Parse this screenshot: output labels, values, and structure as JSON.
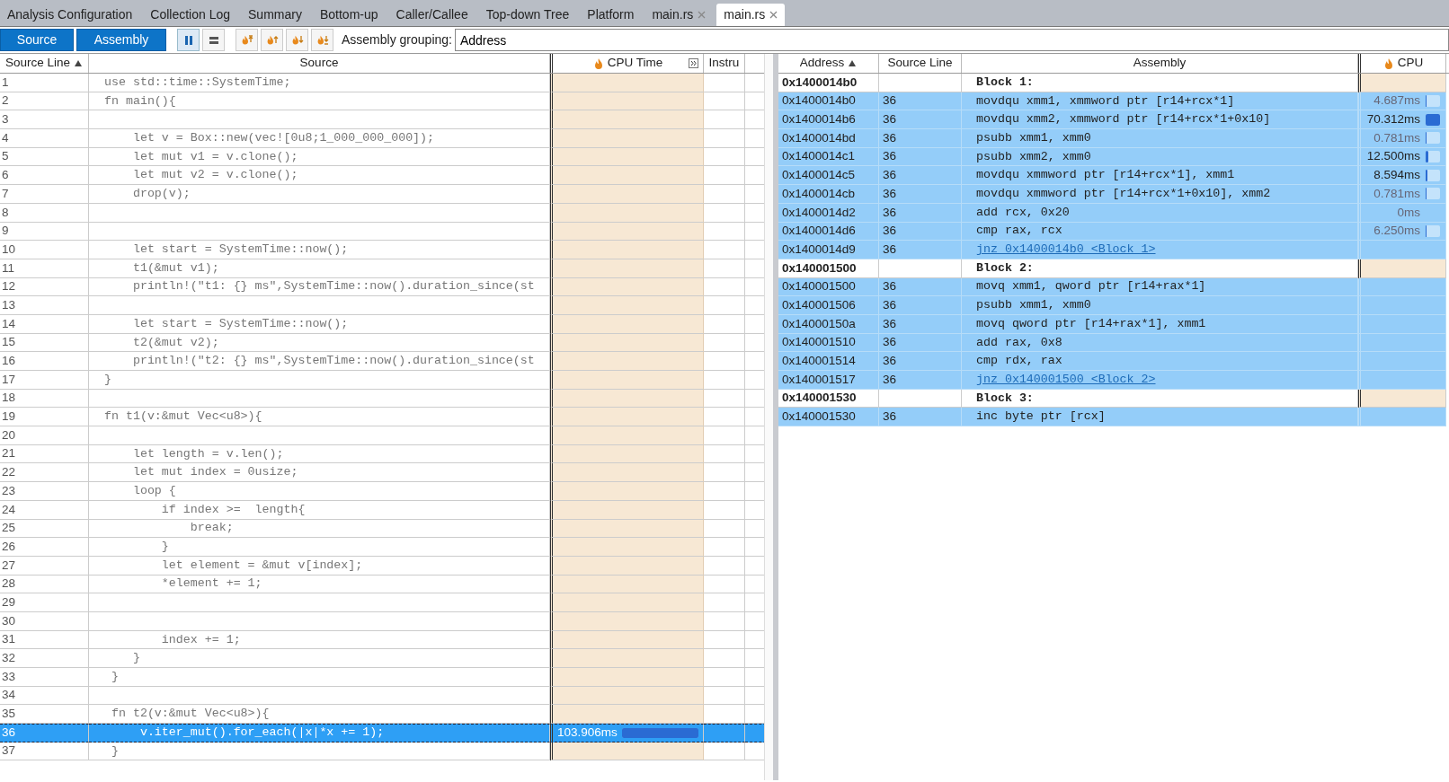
{
  "tabs": [
    {
      "label": "Analysis Configuration",
      "closable": false,
      "selected": false
    },
    {
      "label": "Collection Log",
      "closable": false,
      "selected": false
    },
    {
      "label": "Summary",
      "closable": false,
      "selected": false
    },
    {
      "label": "Bottom-up",
      "closable": false,
      "selected": false
    },
    {
      "label": "Caller/Callee",
      "closable": false,
      "selected": false
    },
    {
      "label": "Top-down Tree",
      "closable": false,
      "selected": false
    },
    {
      "label": "Platform",
      "closable": false,
      "selected": false
    },
    {
      "label": "main.rs",
      "closable": true,
      "selected": false
    },
    {
      "label": "main.rs",
      "closable": true,
      "selected": true
    }
  ],
  "toolbar": {
    "view_buttons": [
      {
        "label": "Source",
        "selected": true
      },
      {
        "label": "Assembly",
        "selected": true
      }
    ],
    "layout_buttons": [
      {
        "kind": "columns",
        "selected": true
      },
      {
        "kind": "rows",
        "selected": false
      }
    ],
    "navigation_buttons": [
      {
        "kind": "top"
      },
      {
        "kind": "up"
      },
      {
        "kind": "down"
      },
      {
        "kind": "bottom"
      }
    ],
    "grouping": {
      "label": "Assembly grouping:",
      "value": "Address"
    }
  },
  "source_pane": {
    "columns": [
      {
        "label": "Source Line",
        "kind": "text",
        "sorted": true
      },
      {
        "label": "Source",
        "kind": "text",
        "sorted": false
      },
      {
        "label": "CPU Time",
        "kind": "metric",
        "sorted": false
      },
      {
        "label": "Instru",
        "kind": "text",
        "sorted": false
      }
    ],
    "rows": [
      {
        "line": "1",
        "code": "use std::time::SystemTime;",
        "selected": false
      },
      {
        "line": "2",
        "code": "fn main(){",
        "selected": false
      },
      {
        "line": "3",
        "code": "",
        "selected": false
      },
      {
        "line": "4",
        "code": "    let v = Box::new(vec![0u8;1_000_000_000]);",
        "selected": false
      },
      {
        "line": "5",
        "code": "    let mut v1 = v.clone();",
        "selected": false
      },
      {
        "line": "6",
        "code": "    let mut v2 = v.clone();",
        "selected": false
      },
      {
        "line": "7",
        "code": "    drop(v);",
        "selected": false
      },
      {
        "line": "8",
        "code": "",
        "selected": false
      },
      {
        "line": "9",
        "code": "",
        "selected": false
      },
      {
        "line": "10",
        "code": "    let start = SystemTime::now();",
        "selected": false
      },
      {
        "line": "11",
        "code": "    t1(&mut v1);",
        "selected": false
      },
      {
        "line": "12",
        "code": "    println!(\"t1: {} ms\",SystemTime::now().duration_since(st",
        "selected": false
      },
      {
        "line": "13",
        "code": "",
        "selected": false
      },
      {
        "line": "14",
        "code": "    let start = SystemTime::now();",
        "selected": false
      },
      {
        "line": "15",
        "code": "    t2(&mut v2);",
        "selected": false
      },
      {
        "line": "16",
        "code": "    println!(\"t2: {} ms\",SystemTime::now().duration_since(st",
        "selected": false
      },
      {
        "line": "17",
        "code": "}",
        "selected": false
      },
      {
        "line": "18",
        "code": "",
        "selected": false
      },
      {
        "line": "19",
        "code": "fn t1(v:&mut Vec<u8>){",
        "selected": false
      },
      {
        "line": "20",
        "code": "",
        "selected": false
      },
      {
        "line": "21",
        "code": "    let length = v.len();",
        "selected": false
      },
      {
        "line": "22",
        "code": "    let mut index = 0usize;",
        "selected": false
      },
      {
        "line": "23",
        "code": "    loop {",
        "selected": false
      },
      {
        "line": "24",
        "code": "        if index >=  length{",
        "selected": false
      },
      {
        "line": "25",
        "code": "            break;",
        "selected": false
      },
      {
        "line": "26",
        "code": "        }",
        "selected": false
      },
      {
        "line": "27",
        "code": "        let element = &mut v[index];",
        "selected": false
      },
      {
        "line": "28",
        "code": "        *element += 1;",
        "selected": false
      },
      {
        "line": "29",
        "code": "",
        "selected": false
      },
      {
        "line": "30",
        "code": "",
        "selected": false
      },
      {
        "line": "31",
        "code": "        index += 1;",
        "selected": false
      },
      {
        "line": "32",
        "code": "    }",
        "selected": false
      },
      {
        "line": "33",
        "code": " }",
        "selected": false
      },
      {
        "line": "34",
        "code": "",
        "selected": false
      },
      {
        "line": "35",
        "code": " fn t2(v:&mut Vec<u8>){",
        "selected": false
      },
      {
        "line": "36",
        "code": "     v.iter_mut().for_each(|x|*x += 1);",
        "selected": true,
        "cpu_time": "103.906ms",
        "level": 1
      },
      {
        "line": "37",
        "code": " }",
        "selected": false
      }
    ]
  },
  "assembly_pane": {
    "columns": [
      {
        "label": "Address",
        "kind": "text",
        "sorted": true
      },
      {
        "label": "Source Line",
        "kind": "text",
        "sorted": false
      },
      {
        "label": "Assembly",
        "kind": "text",
        "sorted": false
      },
      {
        "label": "CPU",
        "kind": "metric",
        "sorted": false
      }
    ],
    "rows": [
      {
        "kind": "block",
        "address": "0x1400014b0",
        "instruction": "Block 1:",
        "selected": false
      },
      {
        "kind": "instruction",
        "address": "0x1400014b0",
        "source_line": "36",
        "instruction": "movdqu xmm1, xmmword ptr [r14+rcx*1]",
        "cpu_time": "4.687ms",
        "muted": true,
        "level": 0.067,
        "selected": true
      },
      {
        "kind": "instruction",
        "address": "0x1400014b6",
        "source_line": "36",
        "instruction": "movdqu xmm2, xmmword ptr [r14+rcx*1+0x10]",
        "cpu_time": "70.312ms",
        "muted": false,
        "level": 1,
        "selected": true
      },
      {
        "kind": "instruction",
        "address": "0x1400014bd",
        "source_line": "36",
        "instruction": "psubb xmm1, xmm0",
        "cpu_time": "0.781ms",
        "muted": true,
        "level": 0.011,
        "selected": true
      },
      {
        "kind": "instruction",
        "address": "0x1400014c1",
        "source_line": "36",
        "instruction": "psubb xmm2, xmm0",
        "cpu_time": "12.500ms",
        "muted": false,
        "level": 0.178,
        "selected": true
      },
      {
        "kind": "instruction",
        "address": "0x1400014c5",
        "source_line": "36",
        "instruction": "movdqu xmmword ptr [r14+rcx*1], xmm1",
        "cpu_time": "8.594ms",
        "muted": false,
        "level": 0.122,
        "selected": true
      },
      {
        "kind": "instruction",
        "address": "0x1400014cb",
        "source_line": "36",
        "instruction": "movdqu xmmword ptr [r14+rcx*1+0x10], xmm2",
        "cpu_time": "0.781ms",
        "muted": true,
        "level": 0.011,
        "selected": true
      },
      {
        "kind": "instruction",
        "address": "0x1400014d2",
        "source_line": "36",
        "instruction": "add rcx, 0x20",
        "cpu_time": "0ms",
        "muted": true,
        "selected": true
      },
      {
        "kind": "instruction",
        "address": "0x1400014d6",
        "source_line": "36",
        "instruction": "cmp rax, rcx",
        "cpu_time": "6.250ms",
        "muted": true,
        "level": 0.089,
        "selected": true
      },
      {
        "kind": "jump",
        "address": "0x1400014d9",
        "source_line": "36",
        "instruction": "jnz 0x1400014b0 <Block 1>",
        "selected": true
      },
      {
        "kind": "block",
        "address": "0x140001500",
        "instruction": "Block 2:",
        "selected": false
      },
      {
        "kind": "instruction",
        "address": "0x140001500",
        "source_line": "36",
        "instruction": "movq xmm1, qword ptr [r14+rax*1]",
        "selected": true
      },
      {
        "kind": "instruction",
        "address": "0x140001506",
        "source_line": "36",
        "instruction": "psubb xmm1, xmm0",
        "selected": true
      },
      {
        "kind": "instruction",
        "address": "0x14000150a",
        "source_line": "36",
        "instruction": "movq qword ptr [r14+rax*1], xmm1",
        "selected": true
      },
      {
        "kind": "instruction",
        "address": "0x140001510",
        "source_line": "36",
        "instruction": "add rax, 0x8",
        "selected": true
      },
      {
        "kind": "instruction",
        "address": "0x140001514",
        "source_line": "36",
        "instruction": "cmp rdx, rax",
        "selected": true
      },
      {
        "kind": "jump",
        "address": "0x140001517",
        "source_line": "36",
        "instruction": "jnz 0x140001500 <Block 2>",
        "selected": true
      },
      {
        "kind": "block",
        "address": "0x140001530",
        "instruction": "Block 3:",
        "selected": false
      },
      {
        "kind": "instruction",
        "address": "0x140001530",
        "source_line": "36",
        "instruction": "inc byte ptr [rcx]",
        "selected": true
      }
    ]
  }
}
